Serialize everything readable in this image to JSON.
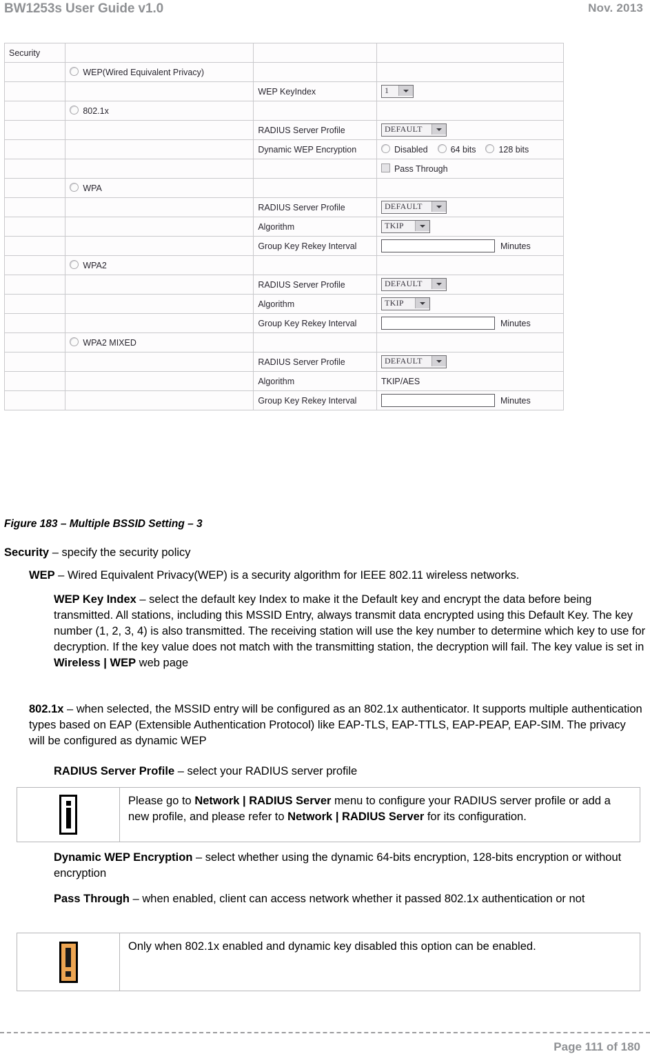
{
  "header": {
    "title": "BW1253s User Guide v1.0",
    "date": "Nov.  2013"
  },
  "figure": {
    "caption": "Figure 183 – Multiple BSSID Setting – 3",
    "section_label": "Security",
    "rows": [
      {
        "c1": "Security",
        "c2": "",
        "c3": "",
        "c4": ""
      },
      {
        "c1": "",
        "c2_radio": "WEP(Wired Equivalent Privacy)",
        "c3": "",
        "c4": ""
      },
      {
        "c1": "",
        "c2": "",
        "c3": "WEP KeyIndex",
        "c4_select": "1"
      },
      {
        "c1": "",
        "c2_radio": "802.1x",
        "c3": "",
        "c4": ""
      },
      {
        "c1": "",
        "c2": "",
        "c3": "RADIUS Server Profile",
        "c4_select": "DEFAULT"
      },
      {
        "c1": "",
        "c2": "",
        "c3": "Dynamic WEP Encryption",
        "c4_radios": [
          "Disabled",
          "64 bits",
          "128 bits"
        ]
      },
      {
        "c1": "",
        "c2": "",
        "c3": "",
        "c4_checkbox": "Pass Through"
      },
      {
        "c1": "",
        "c2_radio": "WPA",
        "c3": "",
        "c4": ""
      },
      {
        "c1": "",
        "c2": "",
        "c3": "RADIUS Server Profile",
        "c4_select": "DEFAULT"
      },
      {
        "c1": "",
        "c2": "",
        "c3": "Algorithm",
        "c4_select": "TKIP"
      },
      {
        "c1": "",
        "c2": "",
        "c3": "Group Key Rekey Interval",
        "c4_input": "",
        "c4_unit": "Minutes"
      },
      {
        "c1": "",
        "c2_radio": "WPA2",
        "c3": "",
        "c4": ""
      },
      {
        "c1": "",
        "c2": "",
        "c3": "RADIUS Server Profile",
        "c4_select": "DEFAULT"
      },
      {
        "c1": "",
        "c2": "",
        "c3": "Algorithm",
        "c4_select": "TKIP"
      },
      {
        "c1": "",
        "c2": "",
        "c3": "Group Key Rekey Interval",
        "c4_input": "",
        "c4_unit": "Minutes"
      },
      {
        "c1": "",
        "c2_radio": "WPA2 MIXED",
        "c3": "",
        "c4": ""
      },
      {
        "c1": "",
        "c2": "",
        "c3": "RADIUS Server Profile",
        "c4_select": "DEFAULT"
      },
      {
        "c1": "",
        "c2": "",
        "c3": "Algorithm",
        "c4_text": "TKIP/AES"
      },
      {
        "c1": "",
        "c2": "",
        "c3": "Group Key Rekey Interval",
        "c4_input": "",
        "c4_unit": "Minutes"
      }
    ]
  },
  "body": {
    "security_term": "Security",
    "security_desc": " – specify the security policy",
    "wep_term": "WEP",
    "wep_desc": " – Wired Equivalent Privacy(WEP) is a security algorithm for IEEE 802.11 wireless networks.",
    "wepkey_term": "WEP Key Index",
    "wepkey_desc_a": " – select the default key Index to make it the Default key and encrypt the data before being transmitted. All stations, including this MSSID Entry, always transmit data encrypted using this Default Key. The key number (1, 2, 3, 4) is also transmitted. The receiving station will use the key number to determine which key to use for decryption. If the key value does not match with the transmitting station, the decryption will fail. The key value is set in ",
    "wepkey_bold_ref": "Wireless | WEP",
    "wepkey_desc_b": " web page",
    "dot1x_term": "802.1x",
    "dot1x_desc": " – when selected, the MSSID entry will be configured as an 802.1x authenticator. It supports multiple authentication types based on EAP (Extensible Authentication Protocol) like EAP-TLS, EAP-TTLS, EAP-PEAP, EAP-SIM. The privacy will be configured as dynamic WEP",
    "radius_term": "RADIUS Server Profile",
    "radius_desc": " – select your RADIUS server profile",
    "dynwep_term": "Dynamic WEP Encryption",
    "dynwep_desc": " – select whether using the dynamic 64-bits encryption, 128-bits encryption or without encryption",
    "passthrough_term": "Pass Through",
    "passthrough_desc": " – when enabled, client can access network whether it passed 802.1x authentication or not"
  },
  "note_info": {
    "icon": "info-icon",
    "text_a": "Please go to ",
    "bold_1": "Network | RADIUS Server",
    "text_b": " menu to configure your RADIUS server profile or add a new profile, and please refer to ",
    "bold_2": "Network | RADIUS Server",
    "text_c": " for its configuration."
  },
  "note_warning": {
    "icon": "warning-icon",
    "text": "Only when 802.1x enabled and dynamic key disabled this option can be enabled."
  },
  "footer": {
    "page_label": "Page 111 of 180"
  }
}
